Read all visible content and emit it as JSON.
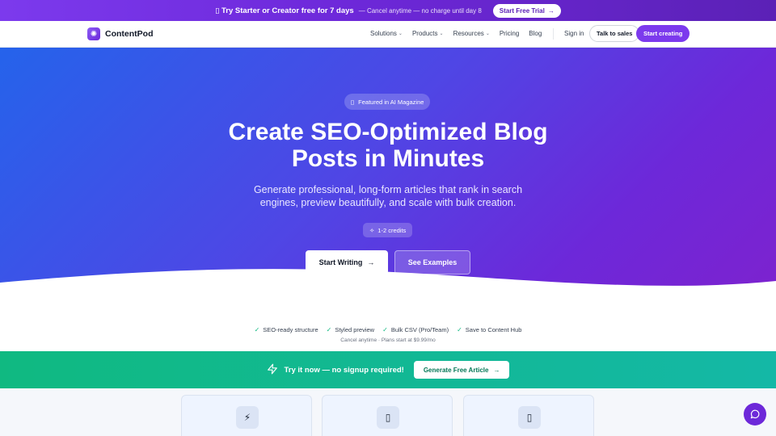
{
  "promo": {
    "headline": "Try Starter or Creator free for 7 days",
    "subtext": "— Cancel anytime — no charge until day 8",
    "cta_label": "Start Free Trial"
  },
  "nav": {
    "brand": "ContentPod",
    "links": [
      {
        "label": "Solutions",
        "has_dropdown": true
      },
      {
        "label": "Products",
        "has_dropdown": true
      },
      {
        "label": "Resources",
        "has_dropdown": true
      },
      {
        "label": "Pricing",
        "has_dropdown": false
      },
      {
        "label": "Blog",
        "has_dropdown": false
      }
    ],
    "sign_in": "Sign in",
    "talk_to_sales": "Talk to sales",
    "start_creating": "Start creating"
  },
  "hero": {
    "badge": "Featured in AI Magazine",
    "title_line1": "Create SEO-Optimized Blog",
    "title_line2": "Posts in Minutes",
    "subtitle": "Generate professional, long-form articles that rank in search engines, preview beautifully, and scale with bulk creation.",
    "credits": "1-2 credits",
    "primary_cta": "Start Writing",
    "secondary_cta": "See Examples"
  },
  "features": {
    "items": [
      "SEO-ready structure",
      "Styled preview",
      "Bulk CSV (Pro/Team)",
      "Save to Content Hub"
    ],
    "fineprint": "Cancel anytime · Plans start at $9.99/mo"
  },
  "try_bar": {
    "text": "Try it now — no signup required!",
    "cta": "Generate Free Article"
  },
  "cards": [
    {
      "icon": "lightning-icon"
    },
    {
      "icon": "document-icon"
    },
    {
      "icon": "document-icon"
    }
  ],
  "colors": {
    "accent": "#7c3aed",
    "hero_start": "#2563eb",
    "hero_end": "#7e22ce",
    "success": "#10b981"
  }
}
